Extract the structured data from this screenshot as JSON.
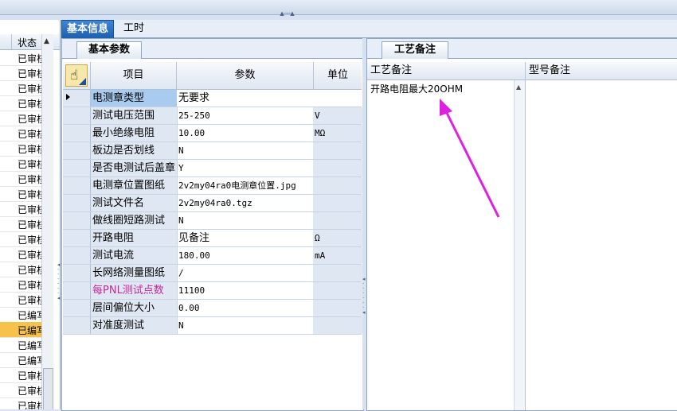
{
  "window": {
    "top_splitter": "▲·······▲"
  },
  "left_list": {
    "header": "状态",
    "items": [
      "已审核",
      "已审核",
      "已审核",
      "已审核",
      "已审核",
      "已审核",
      "已审核",
      "已审核",
      "已审核",
      "已审核",
      "已审核",
      "已审核",
      "已审核",
      "已审核",
      "已审核",
      "已审核",
      "已审核",
      "已编写",
      "已编写",
      "已编写",
      "已编写",
      "已审核",
      "已审核",
      "已审核",
      "已审核"
    ],
    "selected_index": 18
  },
  "main_tabs": [
    "基本信息",
    "工时"
  ],
  "panel_left": {
    "subtab": "基本参数",
    "columns": [
      "项目",
      "参数",
      "单位"
    ],
    "rows": [
      {
        "name": "电测章类型",
        "value": "无要求",
        "unit": ""
      },
      {
        "name": "测试电压范围",
        "value": "25-250",
        "unit": "V"
      },
      {
        "name": "最小绝缘电阻",
        "value": "10.00",
        "unit": "MΩ"
      },
      {
        "name": "板边是否划线",
        "value": "N",
        "unit": ""
      },
      {
        "name": "是否电测试后盖章",
        "value": "Y",
        "unit": ""
      },
      {
        "name": "电测章位置图纸",
        "value": "2v2my04ra0电测章位置.jpg",
        "unit": ""
      },
      {
        "name": "测试文件名",
        "value": "2v2my04ra0.tgz",
        "unit": ""
      },
      {
        "name": "做线圈短路测试",
        "value": "N",
        "unit": ""
      },
      {
        "name": "开路电阻",
        "value": "见备注",
        "unit": "Ω"
      },
      {
        "name": "测试电流",
        "value": "180.00",
        "unit": "mA"
      },
      {
        "name": "长网络测量图纸",
        "value": "/",
        "unit": ""
      },
      {
        "name": "每PNL测试点数",
        "value": "11100",
        "unit": ""
      },
      {
        "name": "层间偏位大小",
        "value": "0.00",
        "unit": ""
      },
      {
        "name": "对准度测试",
        "value": "N",
        "unit": ""
      }
    ]
  },
  "panel_right": {
    "subtab": "工艺备注",
    "columns": [
      "工艺备注",
      "型号备注"
    ],
    "process_note": "开路电阻最大20OHM",
    "annotation_color": "#e020e0"
  }
}
